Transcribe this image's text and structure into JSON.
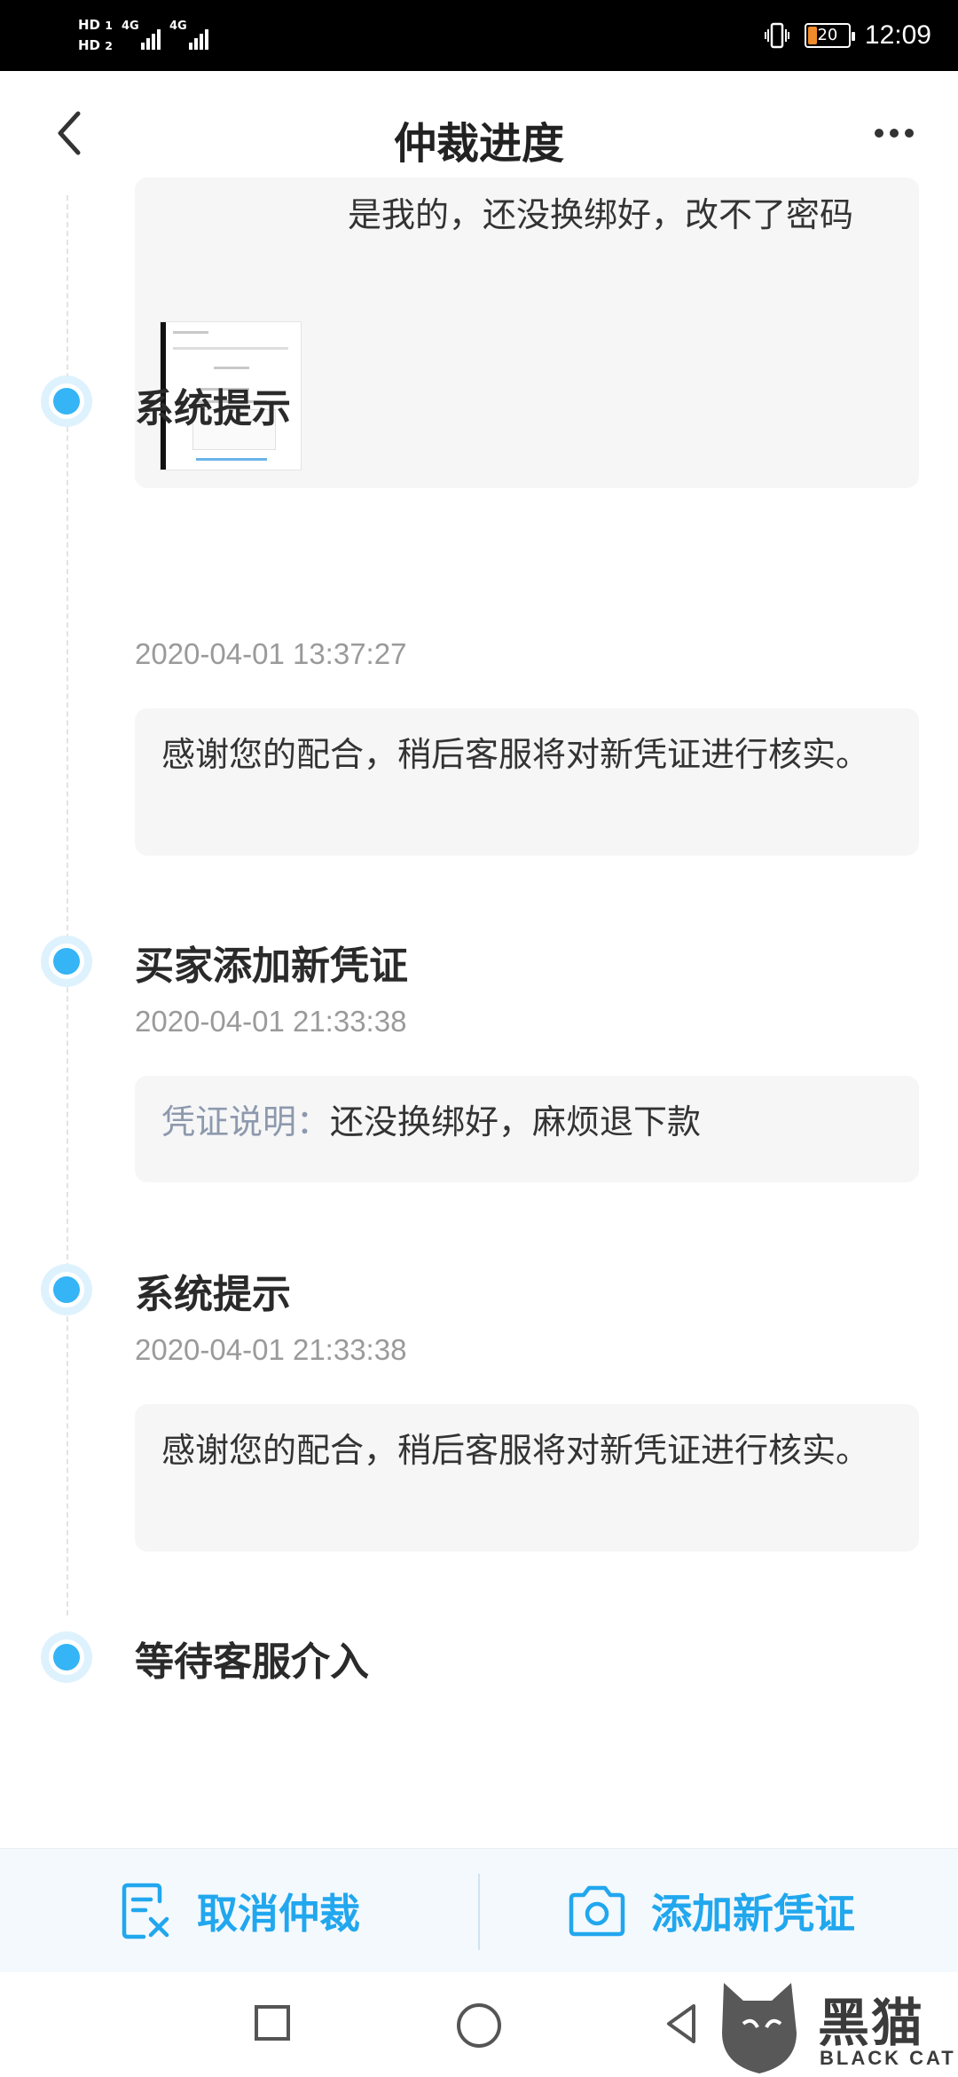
{
  "status_bar": {
    "sim1": "HD",
    "sim1_index": "1",
    "sim2": "HD",
    "sim2_index": "2",
    "network1": "4G",
    "network2": "4G",
    "battery": "20",
    "time": "12:09",
    "icons": [
      "vibrate-icon",
      "battery-icon",
      "signal-icon"
    ]
  },
  "header": {
    "title": "仲裁进度",
    "back_icon": "chevron-left-icon",
    "more_icon": "more-icon"
  },
  "timeline": {
    "first_card_text": "是我的，还没换绑好，改不了密码",
    "events": [
      {
        "title": "系统提示",
        "time": "2020-04-01 13:37:27",
        "content": "感谢您的配合，稍后客服将对新凭证进行核实。"
      },
      {
        "title": "买家添加新凭证",
        "time": "2020-04-01 21:33:38",
        "content_label": "凭证说明：",
        "content": "还没换绑好，麻烦退下款"
      },
      {
        "title": "系统提示",
        "time": "2020-04-01 21:33:38",
        "content": "感谢您的配合，稍后客服将对新凭证进行核实。"
      },
      {
        "title": "等待客服介入"
      }
    ]
  },
  "actions": {
    "cancel_label": "取消仲裁",
    "cancel_icon": "cancel-document-icon",
    "add_label": "添加新凭证",
    "add_icon": "camera-icon"
  },
  "watermark": {
    "text": "黑猫",
    "sub": "BLACK CAT"
  },
  "colors": {
    "accent": "#21a7ee",
    "dot": "#35b4f6",
    "card_bg": "#f6f6f7",
    "timestamp": "#9a9a9a"
  }
}
